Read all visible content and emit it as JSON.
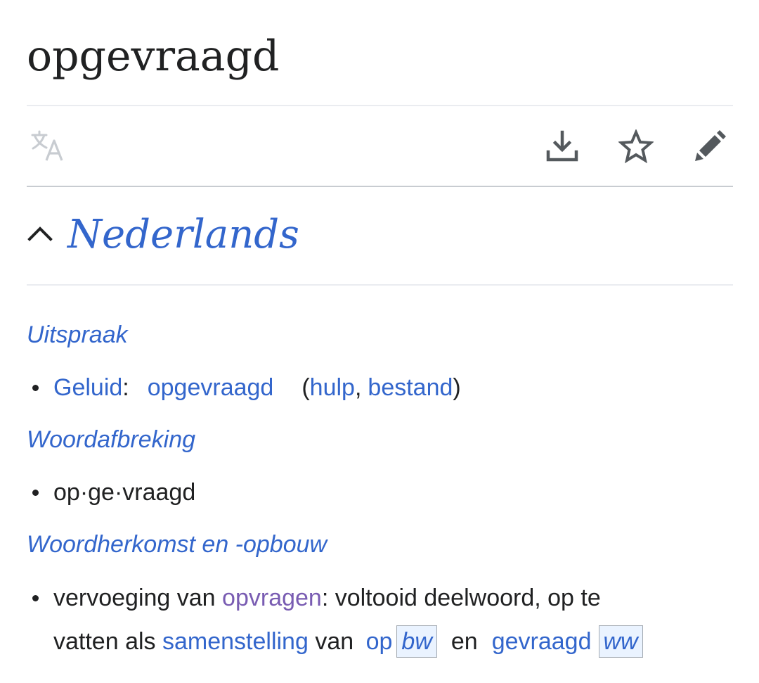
{
  "page": {
    "title": "opgevraagd"
  },
  "toolbar": {
    "language_icon": "translate-icon",
    "download_icon": "download-icon",
    "star_icon": "star-icon",
    "edit_icon": "pencil-icon"
  },
  "section": {
    "chevron_icon": "chevron-up-icon",
    "title": "Nederlands"
  },
  "uitspraak": {
    "heading": "Uitspraak",
    "geluid_label": "Geluid",
    "colon": ":",
    "audio_link": "opgevraagd",
    "open_paren": "(",
    "hulp_link": "hulp",
    "comma": ",",
    "bestand_link": "bestand",
    "close_paren": ")"
  },
  "woordafbreking": {
    "heading": "Woordafbreking",
    "hyphenation": "op·ge·vraagd"
  },
  "woordherkomst": {
    "heading": "Woordherkomst en -opbouw",
    "line1_prefix": "vervoeging van ",
    "opvragen_link": "opvragen",
    "line1_suffix": ": voltooid deelwoord, op te",
    "line2_prefix": "vatten als ",
    "samenstelling_link": "samenstelling",
    "van_text": " van ",
    "op_link": "op",
    "bw_tag": "bw",
    "en_text": "en",
    "gevraagd_link": "gevraagd",
    "ww_tag": "ww"
  },
  "colors": {
    "link": "#3366cc",
    "visited_link": "#795cb2",
    "text": "#202122",
    "divider": "#eaecf0",
    "icon_dark": "#54595d",
    "icon_disabled": "#c8ccd1"
  }
}
